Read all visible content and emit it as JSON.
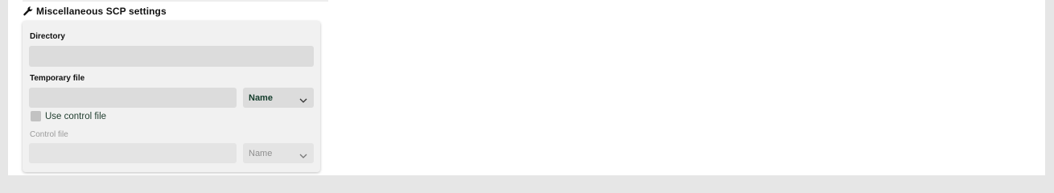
{
  "section": {
    "title": "Miscellaneous SCP settings",
    "icon": "wrench-icon"
  },
  "fields": {
    "directory": {
      "label": "Directory",
      "value": ""
    },
    "temporary_file": {
      "label": "Temporary file",
      "value": "",
      "select_value": "Name"
    },
    "use_control_file": {
      "label": "Use control file",
      "checked": false
    },
    "control_file": {
      "label": "Control file",
      "value": "",
      "select_value": "Name",
      "disabled": true
    }
  },
  "colors": {
    "background": "#e6e6e6",
    "card": "#f1f1f1",
    "input": "#dcdcdc",
    "select_text": "#123b2a"
  }
}
